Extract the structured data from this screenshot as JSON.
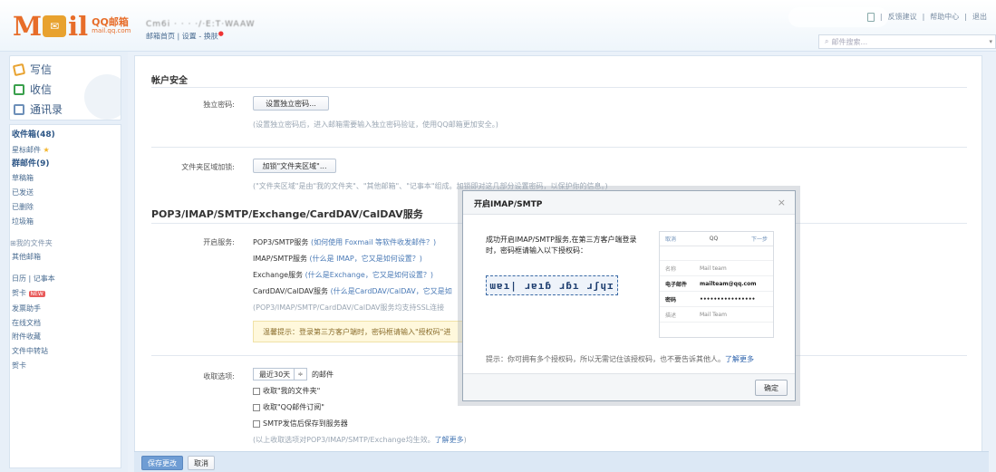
{
  "header": {
    "logo_letters_left": "M",
    "logo_letters_right": "il",
    "logo_title": "QQ邮箱",
    "logo_sub": "mail.qq.com",
    "user_blurred": "Cm6i · · · ·/·E:T·WAAW",
    "nav_home": "邮箱首页",
    "nav_sep": "|",
    "nav_settings": "设置",
    "nav_dash": "-",
    "nav_skin": "换肤",
    "feedback": "反馈建议",
    "help": "帮助中心",
    "logout": "退出",
    "search_placeholder": "邮件搜索..."
  },
  "sidebar": {
    "write": "写信",
    "receive": "收信",
    "contacts": "通讯录",
    "folders": [
      {
        "label": "收件箱(48)",
        "bold": true
      },
      {
        "label": "星标邮件",
        "star": true
      },
      {
        "label": "群邮件(9)",
        "bold": true
      },
      {
        "label": "草稿箱"
      },
      {
        "label": "已发送"
      },
      {
        "label": "已删除"
      },
      {
        "label": "垃圾箱"
      }
    ],
    "my_folders": "我的文件夹",
    "other_mail": "其他邮箱",
    "calendar": "日历",
    "notepad": "记事本",
    "greeting": "贺卡",
    "greeting_badge": "NEW",
    "invoice": "发票助手",
    "docs": "在线文档",
    "attachments": "附件收藏",
    "transfer": "文件中转站",
    "cards": "贺卡"
  },
  "account_security": {
    "title": "帐户安全",
    "pwd_label": "独立密码:",
    "pwd_button": "设置独立密码...",
    "pwd_hint": "(设置独立密码后，进入邮箱需要输入独立密码验证，使用QQ邮箱更加安全。)",
    "folder_label": "文件夹区域加锁:",
    "folder_button": "加锁\"文件夹区域\"...",
    "folder_hint": "(\"文件夹区域\"是由\"我的文件夹\"、\"其他邮箱\"、\"记事本\"组成。加锁即对这几部分设置密码，以保护你的信息。)"
  },
  "pop": {
    "title": "POP3/IMAP/SMTP/Exchange/CardDAV/CalDAV服务",
    "service_label": "开启服务:",
    "l1_a": "POP3/SMTP服务",
    "l1_b": "(如何使用 Foxmail 等软件收发邮件？)",
    "l2_a": "IMAP/SMTP服务",
    "l2_b": "(什么是 IMAP，它又是如何设置？)",
    "l3_a": "Exchange服务",
    "l3_b": "(什么是Exchange，它又是如何设置？)",
    "l4_a": "CardDAV/CalDAV服务",
    "l4_b": "(什么是CardDAV/CalDAV，它又是如",
    "l5": "(POP3/IMAP/SMTP/CardDAV/CalDAV服务均支持SSL连接",
    "tip": "温馨提示：登录第三方客户端时，密码框请输入\"授权码\"进"
  },
  "receive": {
    "label": "收取选项:",
    "range": "最近30天",
    "range_arrow": "≑",
    "suffix": "的邮件",
    "opt1": "收取\"我的文件夹\"",
    "opt2": "收取\"QQ邮件订阅\"",
    "opt3": "SMTP发信后保存到服务器",
    "hint_a": "(以上收取选项对POP3/IMAP/SMTP/Exchange均生效。",
    "hint_link": "了解更多",
    "hint_b": ")"
  },
  "footer": {
    "save": "保存更改",
    "cancel": "取消"
  },
  "modal": {
    "title": "开启IMAP/SMTP",
    "close": "×",
    "message": "成功开启IMAP/SMTP服务,在第三方客户端登录时，密码框请输入以下授权码：",
    "code": "ɯɐı| ɹɐıɓ ɹɓı ɹʃɥɪ",
    "phone": {
      "cancel": "取消",
      "title": "QQ",
      "next": "下一步",
      "rows": [
        {
          "k": "名称",
          "v": "Mail team"
        },
        {
          "k": "电子邮件",
          "v": "mailteam@qq.com",
          "strong": true
        },
        {
          "k": "密码",
          "v": "••••••••••••••••",
          "strong": true
        },
        {
          "k": "描述",
          "v": "Mail Team"
        }
      ]
    },
    "footnote": "提示：你可拥有多个授权码，所以无需记住该授权码，也不要告诉其他人。",
    "footnote_link": "了解更多",
    "ok": "确定"
  }
}
